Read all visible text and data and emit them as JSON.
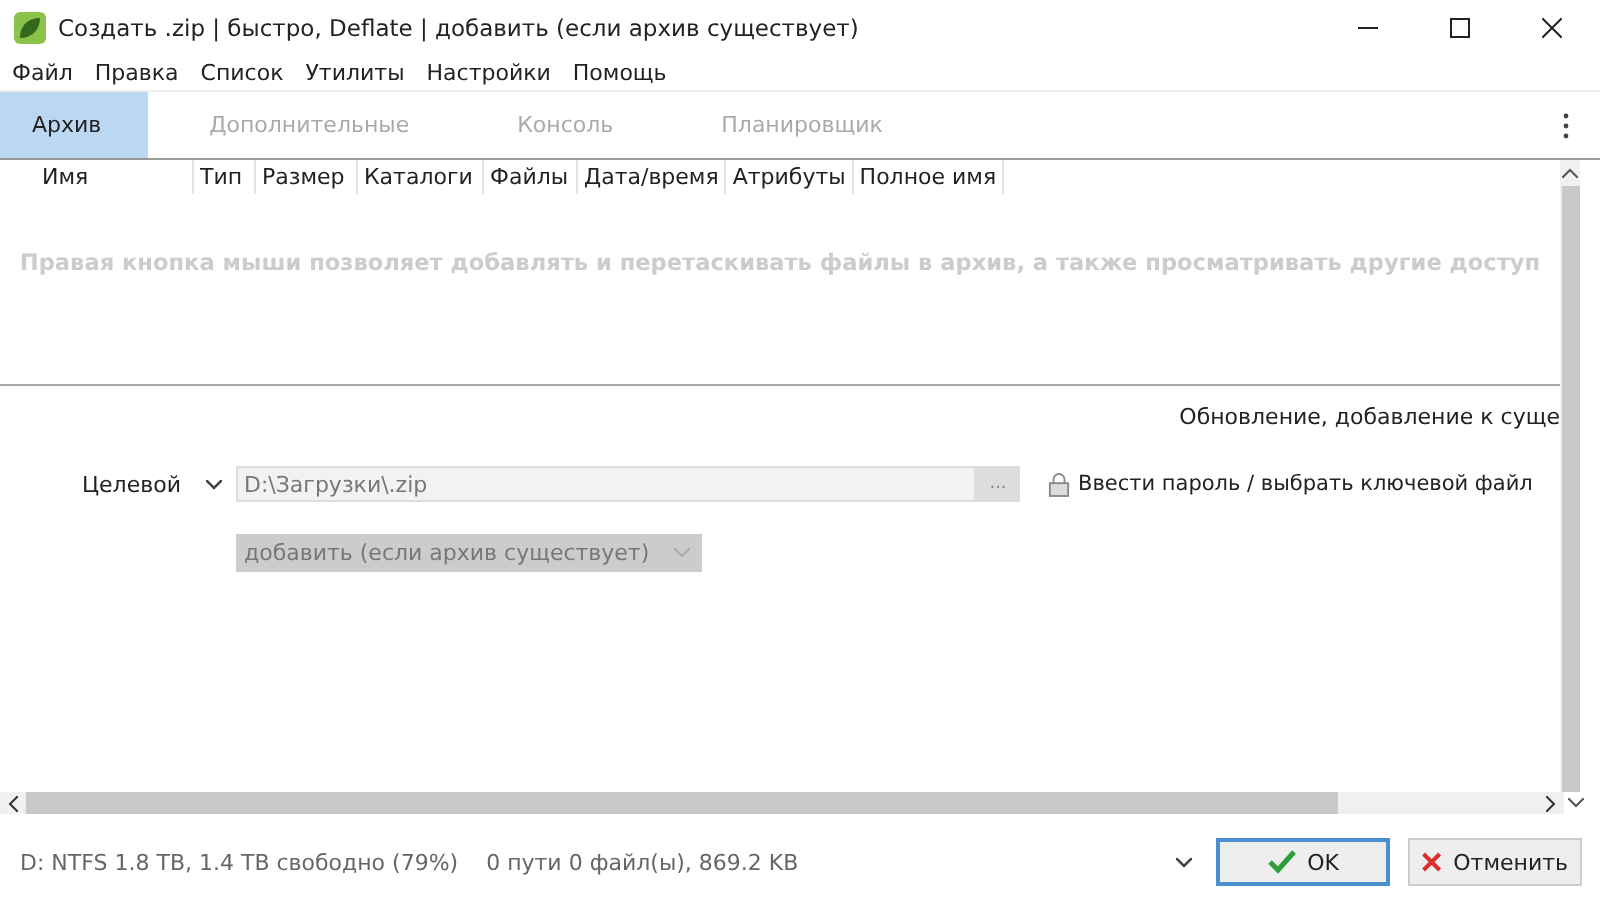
{
  "window": {
    "title": "Создать .zip | быстро, Deflate | добавить (если архив существует)"
  },
  "menu": [
    "Файл",
    "Правка",
    "Список",
    "Утилиты",
    "Настройки",
    "Помощь"
  ],
  "tabs": [
    {
      "label": "Архив",
      "selected": true
    },
    {
      "label": "Дополнительные",
      "selected": false
    },
    {
      "label": "Консоль",
      "selected": false
    },
    {
      "label": "Планировщик",
      "selected": false
    }
  ],
  "table": {
    "columns": [
      "Имя",
      "Тип",
      "Размер",
      "Каталоги",
      "Файлы",
      "Дата/время",
      "Атрибуты",
      "Полное имя"
    ],
    "hint": "Правая кнопка мыши позволяет добавлять и перетаскивать файлы в архив, а также просматривать другие доступ"
  },
  "options": {
    "info": "Обновление, добавление к суще",
    "target_label": "Целевой",
    "path": "D:\\Загрузки\\.zip",
    "browse": "...",
    "password_link": "Ввести пароль / выбрать ключевой файл",
    "update_mode": "добавить (если архив существует)"
  },
  "status_bar": {
    "disk": "D: NTFS 1.8 TB, 1.4 TB свободно (79%)",
    "selection": "0 пути 0 файл(ы), 869.2 KB"
  },
  "buttons": [
    {
      "label": "OK",
      "kind": "ok"
    },
    {
      "label": "Отменить",
      "kind": "cancel"
    }
  ]
}
